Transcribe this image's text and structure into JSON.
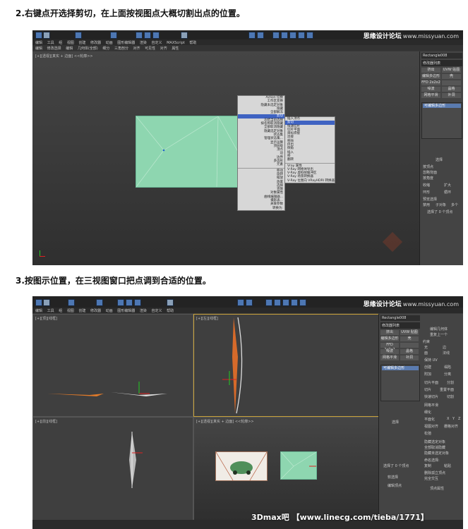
{
  "step2": {
    "caption": "2.右键点开选择剪切，在上面按视图点大概切割出点的位置。",
    "brand": {
      "cn": "思缘设计论坛",
      "url": "www.missyuan.com"
    },
    "menubar": [
      "编辑",
      "工具",
      "组",
      "视图",
      "创建",
      "修改器",
      "动画",
      "图形编辑器",
      "渲染",
      "自定义",
      "MAXScript",
      "帮助"
    ],
    "menubar2": [
      "编辑",
      "修改选择",
      "编辑",
      "几何体(全部)",
      "细分",
      "三角剖分",
      "对齐",
      "可见性",
      "对齐",
      "属性"
    ],
    "viewport_label": "[+][透视][真实 + 边面] <<轮廓>>",
    "cmd_object_name": "Rectangle008",
    "cmd_modifier_list": "修改器列表",
    "cmd_buttons": [
      "挤出",
      "UVW 贴图",
      "编辑多边形",
      "壳",
      "FFD 2x2x2",
      "",
      "噪波",
      "晶格",
      "网格平滑",
      "补洞"
    ],
    "stack_item": "可编辑多边形",
    "rollout_select_title": "选择",
    "rollout_select_opts": [
      "按顶点",
      "忽略背面",
      "按角度",
      "收缩",
      "扩大",
      "环形",
      "循环"
    ],
    "rollout_preview": "预览选择",
    "rollout_radio": [
      "禁用",
      "子对象",
      "多个"
    ],
    "selected_count": "选择了 0 个顶点",
    "context_left": [
      "Action 切换",
      "工作区变换",
      "隐藏未选定对象",
      "隐藏",
      "全部解冻",
      "冻结当前选择",
      "按名称取消隐藏",
      "全部取消隐藏",
      "隐藏选定对象",
      "状态集",
      "管理状态集...",
      "显示运算",
      "顶层级",
      "顶点",
      "边",
      "边界",
      "多边形",
      "元素",
      "移动",
      "旋转",
      "缩放",
      "放置",
      "选择",
      "克隆",
      "对象属性",
      "曲线编辑器...",
      "摄影表...",
      "关联参数",
      "转换为:"
    ],
    "context_right": [
      "插入顶点",
      "剪切",
      "快速切片",
      "切片平面",
      "目标焊接",
      "连接",
      "移除",
      "挤出",
      "倒角",
      "插入",
      "桥",
      "翻转",
      "Vray 属性",
      "V-Ray 网格体导出",
      "V-Ray 虚拟帧缓冲区",
      "V-Ray 场景转换器",
      "V-Ray 位图向 VRayHDRI 转换器"
    ],
    "context_highlight_left": "剪切",
    "watermark": "思缘设计论坛"
  },
  "step3": {
    "caption": "3.按图示位置，在三视图窗口把点调到合适的位置。",
    "brand": {
      "cn": "思缘设计论坛",
      "url": "www.missyuan.com"
    },
    "menubar": [
      "编辑",
      "工具",
      "组",
      "视图",
      "创建",
      "修改器",
      "动画",
      "图形编辑器",
      "渲染",
      "自定义",
      "帮助"
    ],
    "viewport_labels": [
      "[+][顶][线框]",
      "[+][左][线框]",
      "[+][前][线框]",
      "[+][透视][真实 + 边面] <<轮廓>>"
    ],
    "cmd_object_name": "Rectangle008",
    "cmd_modifier_list": "修改器列表",
    "cmd_buttons": [
      "挤出",
      "UVW 贴图",
      "编辑多边形",
      "壳",
      "FFD 2x2x2",
      "",
      "噪波",
      "晶格",
      "网格平滑",
      "补洞"
    ],
    "stack_item": "可编辑多边形",
    "rollout_select_title": "选择",
    "rollout_edit_title": "编辑几何体",
    "selected_count": "选择了 0 个顶点",
    "rollout_soft": "软选择",
    "rollout_vertex_edit": "编辑顶点",
    "rollout_vertex_props": "顶点属性",
    "right_panel_labels": [
      "编辑几何体",
      "重复上一个",
      "约束",
      "无",
      "边",
      "面",
      "法线",
      "保持 UV",
      "创建",
      "塌陷",
      "附加",
      "分离",
      "切片平面",
      "分割",
      "切片",
      "重置平面",
      "快速切片",
      "切割",
      "网格平滑",
      "细化",
      "平面化",
      "X",
      "Y",
      "Z",
      "视图对齐",
      "栅格对齐",
      "松弛",
      "隐藏选定对象",
      "全部取消隐藏",
      "隐藏未选定对象",
      "命名选择:",
      "复制",
      "粘贴",
      "删除孤立顶点",
      "完全交互"
    ],
    "bottom_text": "3Dmax吧 【www.linecg.com/tieba/1771】"
  }
}
